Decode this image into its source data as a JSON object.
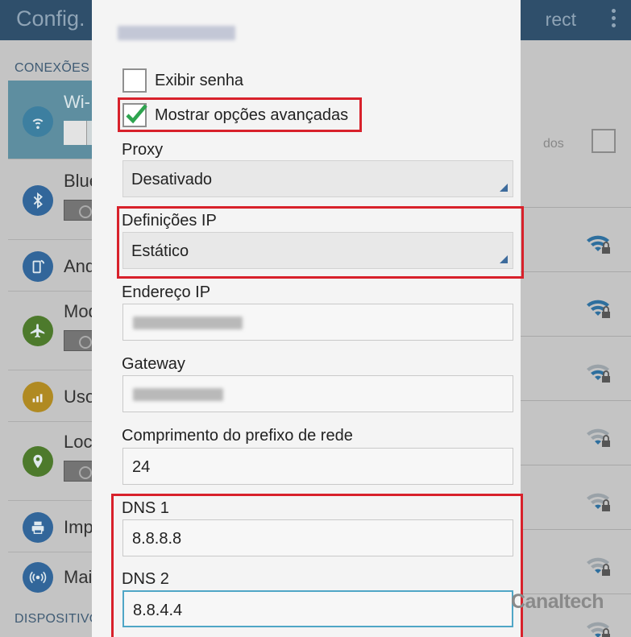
{
  "background": {
    "app_title": "Config.",
    "action_right_text": "rect",
    "section_connections": "CONEXÕES",
    "section_devices": "DISPOSITIVO",
    "left_items": [
      {
        "label": "Wi-",
        "icon": "wifi-icon"
      },
      {
        "label": "Blue",
        "icon": "bluetooth-icon"
      },
      {
        "label": "And",
        "icon": "android-beam-icon"
      },
      {
        "label": "Mod",
        "icon": "airplane-icon"
      },
      {
        "label": "Uso",
        "icon": "data-usage-icon"
      },
      {
        "label": "Loc",
        "icon": "location-icon"
      },
      {
        "label": "Imp",
        "icon": "printer-icon"
      },
      {
        "label": "Mai",
        "icon": "more-networks-icon"
      }
    ],
    "right_text": "dos"
  },
  "dialog": {
    "title_blurred": "",
    "show_password": {
      "label": "Exibir senha",
      "checked": false
    },
    "advanced_options": {
      "label": "Mostrar opções avançadas",
      "checked": true
    },
    "proxy": {
      "label": "Proxy",
      "value": "Desativado"
    },
    "ip_settings": {
      "label": "Definições IP",
      "value": "Estático"
    },
    "ip_address": {
      "label": "Endereço IP",
      "value_blurred": ""
    },
    "gateway": {
      "label": "Gateway",
      "value_blurred": ""
    },
    "prefix_length": {
      "label": "Comprimento do prefixo de rede",
      "value": "24"
    },
    "dns1": {
      "label": "DNS 1",
      "value": "8.8.8.8"
    },
    "dns2": {
      "label": "DNS 2",
      "value": "8.8.4.4"
    }
  },
  "watermark": "Canaltech",
  "colors": {
    "accent": "#4fa6c6",
    "highlight": "#d8212b",
    "check": "#2ea44f",
    "actionbar": "#2f4f6b"
  }
}
